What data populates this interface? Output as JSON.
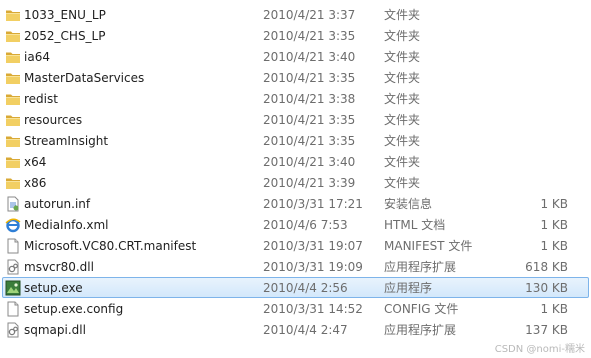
{
  "files": [
    {
      "name": "1033_ENU_LP",
      "date": "2010/4/21 3:37",
      "type": "文件夹",
      "size": "",
      "icon": "folder-icon"
    },
    {
      "name": "2052_CHS_LP",
      "date": "2010/4/21 3:35",
      "type": "文件夹",
      "size": "",
      "icon": "folder-icon"
    },
    {
      "name": "ia64",
      "date": "2010/4/21 3:40",
      "type": "文件夹",
      "size": "",
      "icon": "folder-icon"
    },
    {
      "name": "MasterDataServices",
      "date": "2010/4/21 3:35",
      "type": "文件夹",
      "size": "",
      "icon": "folder-icon"
    },
    {
      "name": "redist",
      "date": "2010/4/21 3:38",
      "type": "文件夹",
      "size": "",
      "icon": "folder-icon"
    },
    {
      "name": "resources",
      "date": "2010/4/21 3:35",
      "type": "文件夹",
      "size": "",
      "icon": "folder-icon"
    },
    {
      "name": "StreamInsight",
      "date": "2010/4/21 3:35",
      "type": "文件夹",
      "size": "",
      "icon": "folder-icon"
    },
    {
      "name": "x64",
      "date": "2010/4/21 3:40",
      "type": "文件夹",
      "size": "",
      "icon": "folder-icon"
    },
    {
      "name": "x86",
      "date": "2010/4/21 3:39",
      "type": "文件夹",
      "size": "",
      "icon": "folder-icon"
    },
    {
      "name": "autorun.inf",
      "date": "2010/3/31 17:21",
      "type": "安装信息",
      "size": "1 KB",
      "icon": "setup-info-file-icon"
    },
    {
      "name": "MediaInfo.xml",
      "date": "2010/4/6 7:53",
      "type": "HTML 文档",
      "size": "1 KB",
      "icon": "ie-document-icon"
    },
    {
      "name": "Microsoft.VC80.CRT.manifest",
      "date": "2010/3/31 19:07",
      "type": "MANIFEST 文件",
      "size": "1 KB",
      "icon": "blank-file-icon"
    },
    {
      "name": "msvcr80.dll",
      "date": "2010/3/31 19:09",
      "type": "应用程序扩展",
      "size": "618 KB",
      "icon": "dll-file-icon"
    },
    {
      "name": "setup.exe",
      "date": "2010/4/4 2:56",
      "type": "应用程序",
      "size": "130 KB",
      "icon": "setup-exe-icon",
      "selected": true
    },
    {
      "name": "setup.exe.config",
      "date": "2010/3/31 14:52",
      "type": "CONFIG 文件",
      "size": "1 KB",
      "icon": "blank-file-icon"
    },
    {
      "name": "sqmapi.dll",
      "date": "2010/4/4 2:47",
      "type": "应用程序扩展",
      "size": "137 KB",
      "icon": "dll-file-icon"
    }
  ],
  "watermark": "CSDN @nomi-糯米",
  "colors": {
    "selection_bg": "#d9ebfb",
    "selection_border": "#7eb4ea",
    "folder": "#e8c25a",
    "meta_text": "#6d6d6d"
  }
}
